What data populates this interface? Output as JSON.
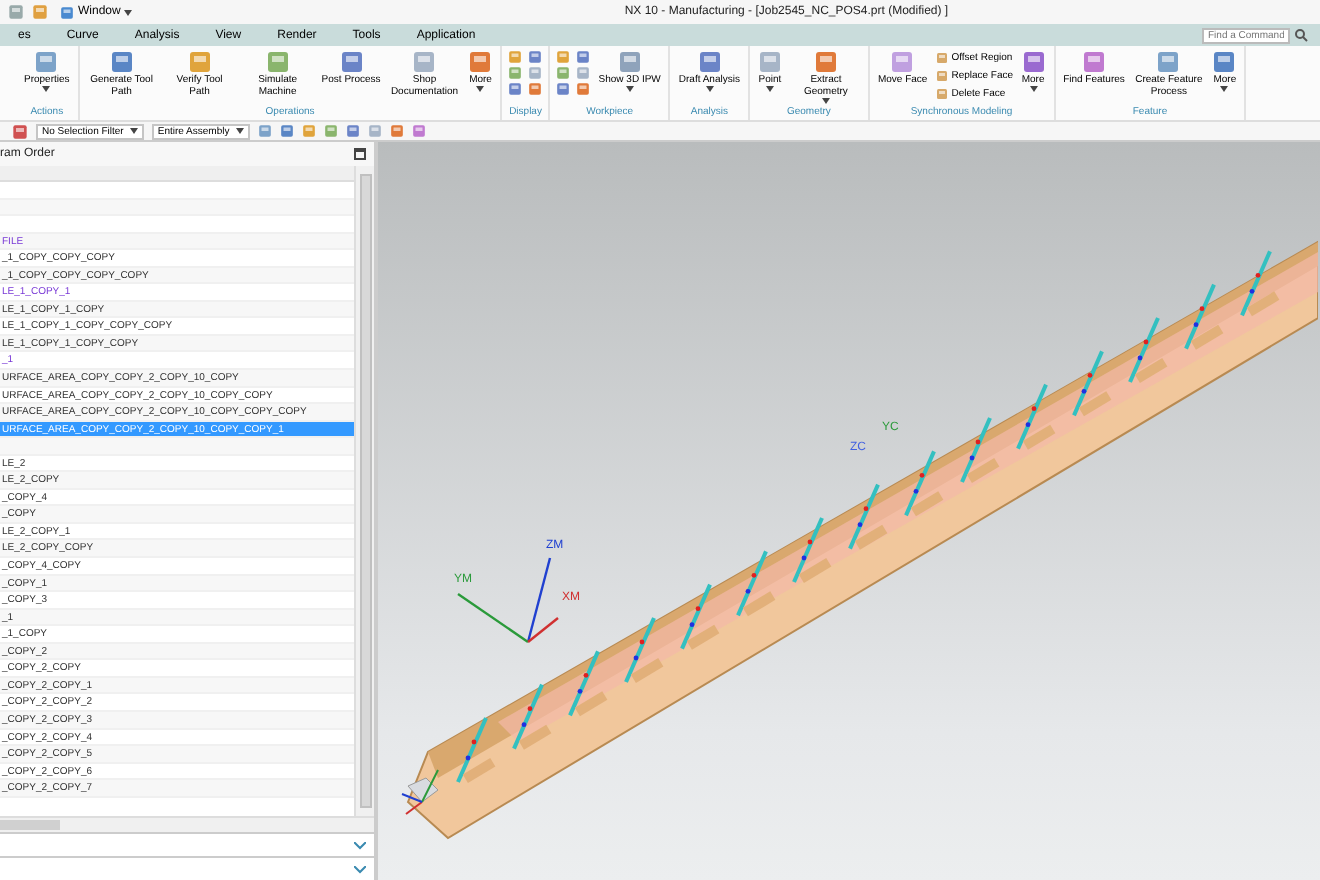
{
  "window": {
    "title": "NX 10 - Manufacturing - [Job2545_NC_POS4.prt (Modified) ]",
    "menu_button": "Window",
    "search": {
      "placeholder": "Find a Command"
    }
  },
  "tabs": [
    {
      "label": "es",
      "selected": false
    },
    {
      "label": "Curve",
      "selected": false
    },
    {
      "label": "Analysis",
      "selected": false
    },
    {
      "label": "View",
      "selected": false
    },
    {
      "label": "Render",
      "selected": false
    },
    {
      "label": "Tools",
      "selected": false
    },
    {
      "label": "Application",
      "selected": false
    }
  ],
  "ribbon_groups": [
    {
      "label": "Actions",
      "kind": "buttons",
      "items": [
        {
          "label": "Properties",
          "dropdown": true
        }
      ]
    },
    {
      "label": "Operations",
      "kind": "buttons",
      "items": [
        {
          "label": "Generate Tool Path",
          "dropdown": false
        },
        {
          "label": "Verify Tool Path",
          "dropdown": false
        },
        {
          "label": "Simulate Machine",
          "dropdown": false
        },
        {
          "label": "Post Process",
          "dropdown": false
        },
        {
          "label": "Shop Documentation",
          "dropdown": false
        },
        {
          "label": "More",
          "dropdown": true
        }
      ]
    },
    {
      "label": "Display",
      "kind": "icon-grid"
    },
    {
      "label": "Workpiece",
      "kind": "icon-grid",
      "items": [
        {
          "label": "Show 3D IPW",
          "dropdown": true
        }
      ]
    },
    {
      "label": "Analysis",
      "kind": "buttons",
      "items": [
        {
          "label": "Draft Analysis",
          "dropdown": true
        }
      ]
    },
    {
      "label": "Geometry",
      "kind": "buttons",
      "items": [
        {
          "label": "Point",
          "dropdown": true
        },
        {
          "label": "Extract Geometry",
          "dropdown": true
        }
      ]
    },
    {
      "label": "Synchronous Modeling",
      "kind": "sync",
      "items": [
        {
          "label": "Move Face",
          "dropdown": false
        },
        {
          "label": "Offset Region",
          "dropdown": false
        },
        {
          "label": "Replace Face",
          "dropdown": false
        },
        {
          "label": "Delete Face",
          "dropdown": false
        },
        {
          "label": "More",
          "dropdown": true
        }
      ]
    },
    {
      "label": "Feature",
      "kind": "buttons",
      "items": [
        {
          "label": "Find Features",
          "dropdown": false
        },
        {
          "label": "Create Feature Process",
          "dropdown": false
        },
        {
          "label": "More",
          "dropdown": true
        }
      ]
    }
  ],
  "toolbar": {
    "selection_filter": "No Selection Filter",
    "scope": "Entire Assembly"
  },
  "navigator": {
    "title": "ram Order",
    "rows": [
      {
        "kind": "blank",
        "selected": false
      },
      {
        "kind": "blank",
        "selected": false
      },
      {
        "kind": "blank",
        "selected": false
      },
      {
        "kind": "program",
        "text": "FILE",
        "selected": false
      },
      {
        "kind": "operation",
        "text": "_1_COPY_COPY_COPY",
        "selected": false
      },
      {
        "kind": "operation",
        "text": "_1_COPY_COPY_COPY_COPY",
        "selected": false
      },
      {
        "kind": "program",
        "text": "LE_1_COPY_1",
        "selected": false
      },
      {
        "kind": "operation",
        "text": "LE_1_COPY_1_COPY",
        "selected": false
      },
      {
        "kind": "operation",
        "text": "LE_1_COPY_1_COPY_COPY_COPY",
        "selected": false
      },
      {
        "kind": "operation",
        "text": "LE_1_COPY_1_COPY_COPY",
        "selected": false
      },
      {
        "kind": "program",
        "text": "_1",
        "selected": false
      },
      {
        "kind": "operation",
        "text": "URFACE_AREA_COPY_COPY_2_COPY_10_COPY",
        "selected": false
      },
      {
        "kind": "operation",
        "text": "URFACE_AREA_COPY_COPY_2_COPY_10_COPY_COPY",
        "selected": false
      },
      {
        "kind": "operation",
        "text": "URFACE_AREA_COPY_COPY_2_COPY_10_COPY_COPY_COPY",
        "selected": false
      },
      {
        "kind": "operation",
        "text": "URFACE_AREA_COPY_COPY_2_COPY_10_COPY_COPY_1",
        "selected": true
      },
      {
        "kind": "blank",
        "selected": false
      },
      {
        "kind": "operation",
        "text": "LE_2",
        "selected": false
      },
      {
        "kind": "operation",
        "text": "LE_2_COPY",
        "selected": false
      },
      {
        "kind": "operation",
        "text": "_COPY_4",
        "selected": false
      },
      {
        "kind": "operation",
        "text": "_COPY",
        "selected": false
      },
      {
        "kind": "operation",
        "text": "LE_2_COPY_1",
        "selected": false
      },
      {
        "kind": "operation",
        "text": "LE_2_COPY_COPY",
        "selected": false
      },
      {
        "kind": "operation",
        "text": "_COPY_4_COPY",
        "selected": false
      },
      {
        "kind": "operation",
        "text": "_COPY_1",
        "selected": false
      },
      {
        "kind": "operation",
        "text": "_COPY_3",
        "selected": false
      },
      {
        "kind": "operation",
        "text": "_1",
        "selected": false
      },
      {
        "kind": "operation",
        "text": "_1_COPY",
        "selected": false
      },
      {
        "kind": "operation",
        "text": "_COPY_2",
        "selected": false
      },
      {
        "kind": "operation",
        "text": "_COPY_2_COPY",
        "selected": false
      },
      {
        "kind": "operation",
        "text": "_COPY_2_COPY_1",
        "selected": false
      },
      {
        "kind": "operation",
        "text": "_COPY_2_COPY_2",
        "selected": false
      },
      {
        "kind": "operation",
        "text": "_COPY_2_COPY_3",
        "selected": false
      },
      {
        "kind": "operation",
        "text": "_COPY_2_COPY_4",
        "selected": false
      },
      {
        "kind": "operation",
        "text": "_COPY_2_COPY_5",
        "selected": false
      },
      {
        "kind": "operation",
        "text": "_COPY_2_COPY_6",
        "selected": false
      },
      {
        "kind": "operation",
        "text": "_COPY_2_COPY_7",
        "selected": false
      }
    ],
    "collapsed_panes": [
      {
        "expanded": false
      },
      {
        "expanded": false
      }
    ]
  },
  "viewport": {
    "axis_labels": [
      {
        "kind": "zm",
        "text": "ZM"
      },
      {
        "kind": "ym",
        "text": "YM"
      },
      {
        "kind": "xm",
        "text": "XM"
      },
      {
        "kind": "zc",
        "text": "ZC"
      },
      {
        "kind": "yc",
        "text": "YC"
      }
    ]
  }
}
